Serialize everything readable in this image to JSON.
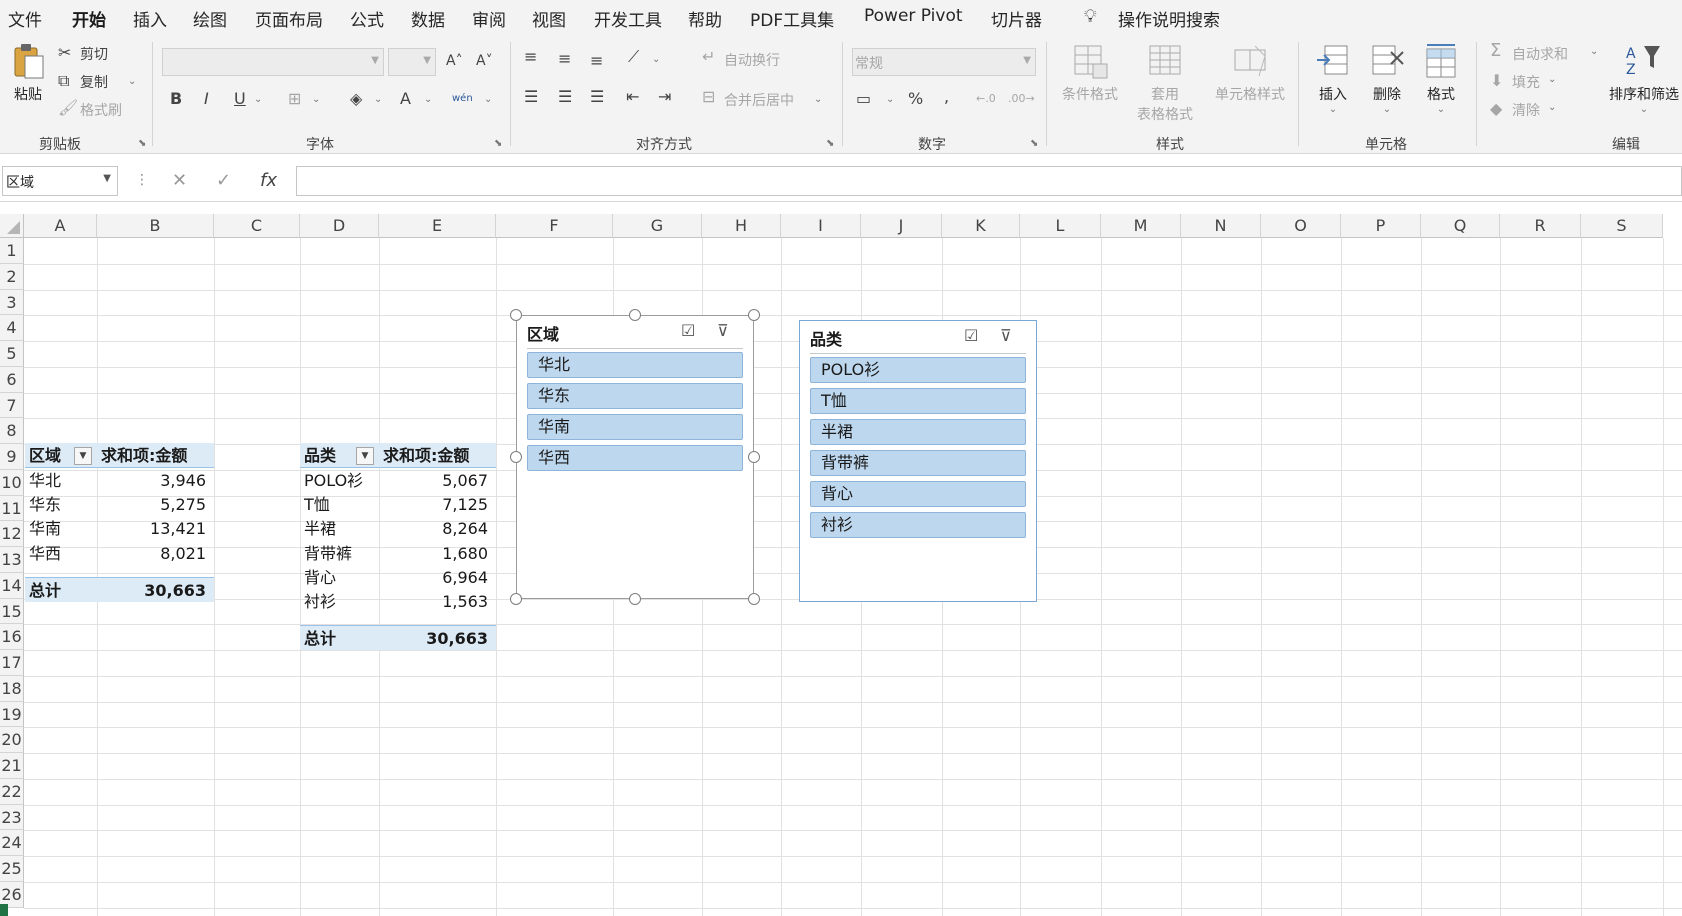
{
  "menu": [
    "文件",
    "开始",
    "插入",
    "绘图",
    "页面布局",
    "公式",
    "数据",
    "审阅",
    "视图",
    "开发工具",
    "帮助",
    "PDF工具集",
    "Power Pivot",
    "切片器"
  ],
  "active_menu": "开始",
  "tell_me": "操作说明搜索",
  "ribbon": {
    "clipboard": {
      "paste": "粘贴",
      "cut": "剪切",
      "copy": "复制",
      "format_painter": "格式刷",
      "label": "剪贴板"
    },
    "font": {
      "label": "字体",
      "bold": "B",
      "italic": "I",
      "underline": "U",
      "font_color": "A",
      "phonetic": "wén"
    },
    "alignment": {
      "wrap_text": "自动换行",
      "merge_center": "合并后居中",
      "label": "对齐方式"
    },
    "number": {
      "format": "常规",
      "percent": "%",
      "comma": ",",
      "label": "数字"
    },
    "styles": {
      "conditional": "条件格式",
      "table_line1": "套用",
      "table_line2": "表格格式",
      "cell_styles": "单元格样式",
      "label": "样式"
    },
    "cells": {
      "insert": "插入",
      "delete": "删除",
      "format": "格式",
      "label": "单元格"
    },
    "editing": {
      "autosum": "自动求和",
      "fill": "填充",
      "clear": "清除",
      "sort_filter": "排序和筛选",
      "label": "编辑"
    }
  },
  "formula_bar": {
    "name_box": "区域",
    "cancel": "✕",
    "enter": "✓",
    "fx": "fx",
    "value": ""
  },
  "columns": [
    "A",
    "B",
    "C",
    "D",
    "E",
    "F",
    "G",
    "H",
    "I",
    "J",
    "K",
    "L",
    "M",
    "N",
    "O",
    "P",
    "Q",
    "R",
    "S"
  ],
  "rows": [
    "1",
    "2",
    "3",
    "4",
    "5",
    "6",
    "7",
    "8",
    "9",
    "10",
    "11",
    "12",
    "13",
    "14",
    "15",
    "16",
    "17",
    "18",
    "19",
    "20",
    "21",
    "22",
    "23",
    "24",
    "25",
    "26"
  ],
  "pivot1": {
    "header": [
      "区域",
      "求和项:金额"
    ],
    "rows": [
      [
        "华北",
        "3,946"
      ],
      [
        "华东",
        "5,275"
      ],
      [
        "华南",
        "13,421"
      ],
      [
        "华西",
        "8,021"
      ]
    ],
    "total": [
      "总计",
      "30,663"
    ]
  },
  "pivot2": {
    "header": [
      "品类",
      "求和项:金额"
    ],
    "rows": [
      [
        "POLO衫",
        "5,067"
      ],
      [
        "T恤",
        "7,125"
      ],
      [
        "半裙",
        "8,264"
      ],
      [
        "背带裤",
        "1,680"
      ],
      [
        "背心",
        "6,964"
      ],
      [
        "衬衫",
        "1,563"
      ]
    ],
    "total": [
      "总计",
      "30,663"
    ]
  },
  "slicer_region": {
    "title": "区域",
    "items": [
      "华北",
      "华东",
      "华南",
      "华西"
    ]
  },
  "slicer_category": {
    "title": "品类",
    "items": [
      "POLO衫",
      "T恤",
      "半裙",
      "背带裤",
      "背心",
      "衬衫"
    ]
  },
  "colors": {
    "accent": "#217346",
    "pivot_header_fill": "#ddebf7",
    "slicer_item_fill": "#bdd7ee"
  }
}
